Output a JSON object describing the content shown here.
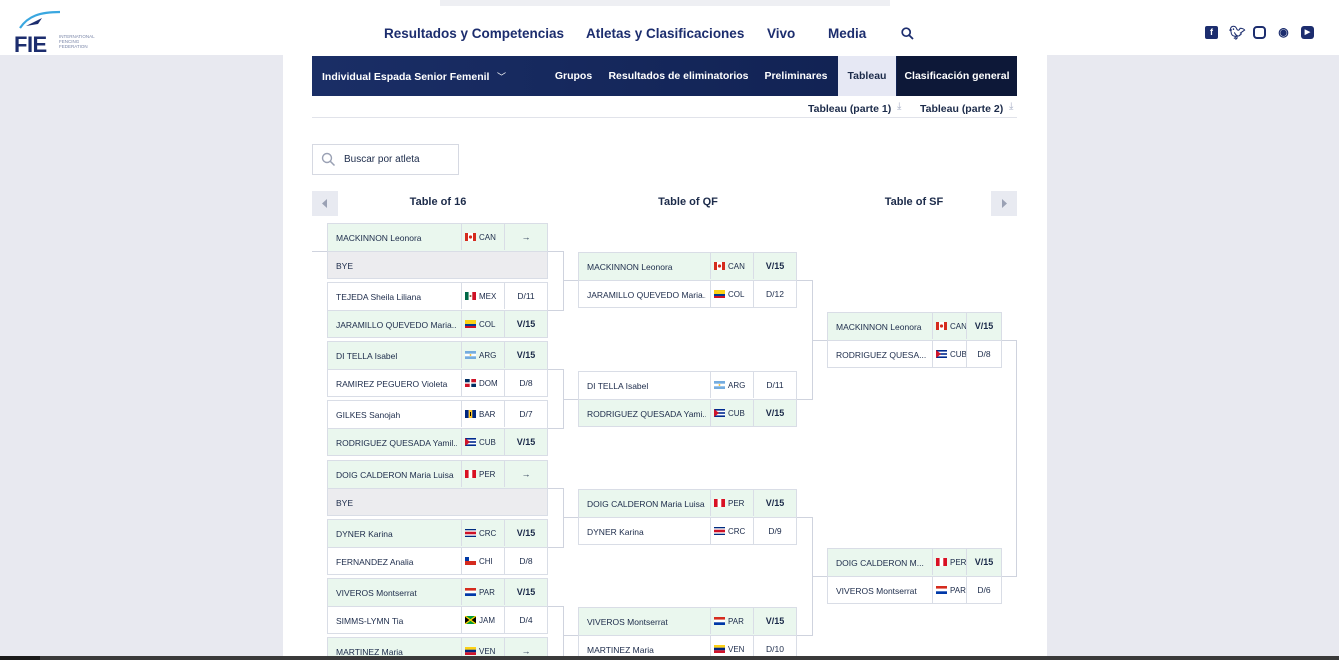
{
  "header": {
    "logo_text": "FIE",
    "logo_sub": "INTERNATIONAL FENCING FEDERATION",
    "nav": [
      "Resultados y Competencias",
      "Atletas y Clasificaciones",
      "Vivo",
      "Media"
    ],
    "social_icons": [
      "facebook-icon",
      "twitter-icon",
      "instagram-icon",
      "weibo-icon",
      "youtube-icon"
    ]
  },
  "event": {
    "selected": "Individual Espada Senior Femenil"
  },
  "tabs": [
    "Grupos",
    "Resultados de eliminatorios",
    "Preliminares",
    "Tableau",
    "Clasificación general"
  ],
  "active_tab": "Tableau",
  "subtabs": [
    "Tableau (parte 1)",
    "Tableau (parte 2)"
  ],
  "search": {
    "placeholder": "Buscar por atleta"
  },
  "columns": [
    "Table of 16",
    "Table of QF",
    "Table of SF"
  ],
  "colors": {
    "navy": "#1c2d6e",
    "win_bg": "#eaf7ee",
    "bye_bg": "#ececef"
  },
  "bouts": {
    "t16": [
      [
        {
          "name": "MACKINNON Leonora",
          "nat": "CAN",
          "score": "→",
          "win": true
        },
        {
          "name": "BYE",
          "nat": "",
          "score": "",
          "bye": true
        }
      ],
      [
        {
          "name": "TEJEDA Sheila Liliana",
          "nat": "MEX",
          "score": "D/11"
        },
        {
          "name": "JARAMILLO QUEVEDO Maria...",
          "nat": "COL",
          "score": "V/15",
          "win": true
        }
      ],
      [
        {
          "name": "DI TELLA Isabel",
          "nat": "ARG",
          "score": "V/15",
          "win": true
        },
        {
          "name": "RAMIREZ PEGUERO Violeta",
          "nat": "DOM",
          "score": "D/8"
        }
      ],
      [
        {
          "name": "GILKES Sanojah",
          "nat": "BAR",
          "score": "D/7"
        },
        {
          "name": "RODRIGUEZ QUESADA Yamil...",
          "nat": "CUB",
          "score": "V/15",
          "win": true
        }
      ],
      [
        {
          "name": "DOIG CALDERON Maria Luisa",
          "nat": "PER",
          "score": "→",
          "win": true
        },
        {
          "name": "BYE",
          "nat": "",
          "score": "",
          "bye": true
        }
      ],
      [
        {
          "name": "DYNER Karina",
          "nat": "CRC",
          "score": "V/15",
          "win": true
        },
        {
          "name": "FERNANDEZ Analia",
          "nat": "CHI",
          "score": "D/8"
        }
      ],
      [
        {
          "name": "VIVEROS Montserrat",
          "nat": "PAR",
          "score": "V/15",
          "win": true
        },
        {
          "name": "SIMMS-LYMN Tia",
          "nat": "JAM",
          "score": "D/4"
        }
      ],
      [
        {
          "name": "MARTINEZ Maria",
          "nat": "VEN",
          "score": "→",
          "win": true
        }
      ]
    ],
    "qf": [
      [
        {
          "name": "MACKINNON Leonora",
          "nat": "CAN",
          "score": "V/15",
          "win": true
        },
        {
          "name": "JARAMILLO QUEVEDO Maria...",
          "nat": "COL",
          "score": "D/12"
        }
      ],
      [
        {
          "name": "DI TELLA Isabel",
          "nat": "ARG",
          "score": "D/11"
        },
        {
          "name": "RODRIGUEZ QUESADA Yami...",
          "nat": "CUB",
          "score": "V/15",
          "win": true
        }
      ],
      [
        {
          "name": "DOIG CALDERON Maria Luisa",
          "nat": "PER",
          "score": "V/15",
          "win": true
        },
        {
          "name": "DYNER Karina",
          "nat": "CRC",
          "score": "D/9"
        }
      ],
      [
        {
          "name": "VIVEROS Montserrat",
          "nat": "PAR",
          "score": "V/15",
          "win": true
        },
        {
          "name": "MARTINEZ Maria",
          "nat": "VEN",
          "score": "D/10"
        }
      ]
    ],
    "sf": [
      [
        {
          "name": "MACKINNON Leonora",
          "nat": "CAN",
          "score": "V/15",
          "win": true
        },
        {
          "name": "RODRIGUEZ QUESA...",
          "nat": "CUB",
          "score": "D/8"
        }
      ],
      [
        {
          "name": "DOIG CALDERON M...",
          "nat": "PER",
          "score": "V/15",
          "win": true
        },
        {
          "name": "VIVEROS Montserrat",
          "nat": "PAR",
          "score": "D/6"
        }
      ]
    ]
  }
}
